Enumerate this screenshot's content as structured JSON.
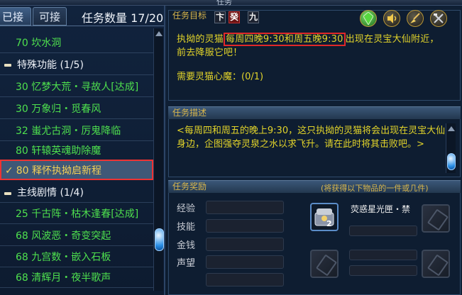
{
  "window": {
    "title": "任务"
  },
  "tabs": [
    {
      "label": "已接",
      "active": true
    },
    {
      "label": "可接",
      "active": false
    }
  ],
  "task_count": {
    "label": "任务数量",
    "value": "17/20"
  },
  "list": [
    {
      "type": "quest",
      "text": "70 坎水洞"
    },
    {
      "type": "category",
      "text": "特殊功能 (1/5)"
    },
    {
      "type": "quest",
      "text": "30 忆梦大荒・寻故人[达成]"
    },
    {
      "type": "quest",
      "text": "30 万象归・觅春风"
    },
    {
      "type": "quest",
      "text": "32 蚩尤古洞・厉鬼降临"
    },
    {
      "type": "quest",
      "text": "80 轩辕英魂助除魔"
    },
    {
      "type": "quest",
      "text": "80 释怀执拗启新程",
      "selected": true,
      "check": "✓"
    },
    {
      "type": "category",
      "text": "主线剧情 (1/4)"
    },
    {
      "type": "quest",
      "text": "25 千古阵・枯木逢春[达成]"
    },
    {
      "type": "quest",
      "text": "68 风波恶・奇变突起"
    },
    {
      "type": "quest",
      "text": "68 九宫数・嵌入石板"
    },
    {
      "type": "quest",
      "text": "68 清辉月・夜半歌声"
    }
  ],
  "goal": {
    "header": "任务目标",
    "badges": [
      "卞",
      "癸",
      "九"
    ],
    "text_prefix": "执拗的灵猫",
    "text_highlight": "每周四晚9:30和周五晚9:30",
    "text_suffix": "出现在灵宝大仙附近，前去降服它吧！",
    "requirement": "需要灵猫心魔：(0/1)"
  },
  "toolbar_icons": [
    "green-gem-icon",
    "volume-icon",
    "broom-icon",
    "crossed-tools-icon"
  ],
  "description": {
    "header": "任务描述",
    "text": "<每周四和周五的晚上9:30，这只执拗的灵猫将会出现在灵宝大仙身边，企图强夺灵泉之水以求飞升。请在此时将其击败吧。>"
  },
  "reward": {
    "header": "任务奖励",
    "hint": "(将获得以下物品的一件或几件)",
    "labels": [
      "经验",
      "技能",
      "金钱",
      "声望"
    ],
    "item": {
      "name": "荧惑星光匣・禁",
      "quantity": "2"
    }
  },
  "colors": {
    "accent_gold": "#d8b64c",
    "quest_green": "#4ee04e",
    "goal_yellow": "#e2d42a",
    "highlight_red": "#e02828"
  }
}
